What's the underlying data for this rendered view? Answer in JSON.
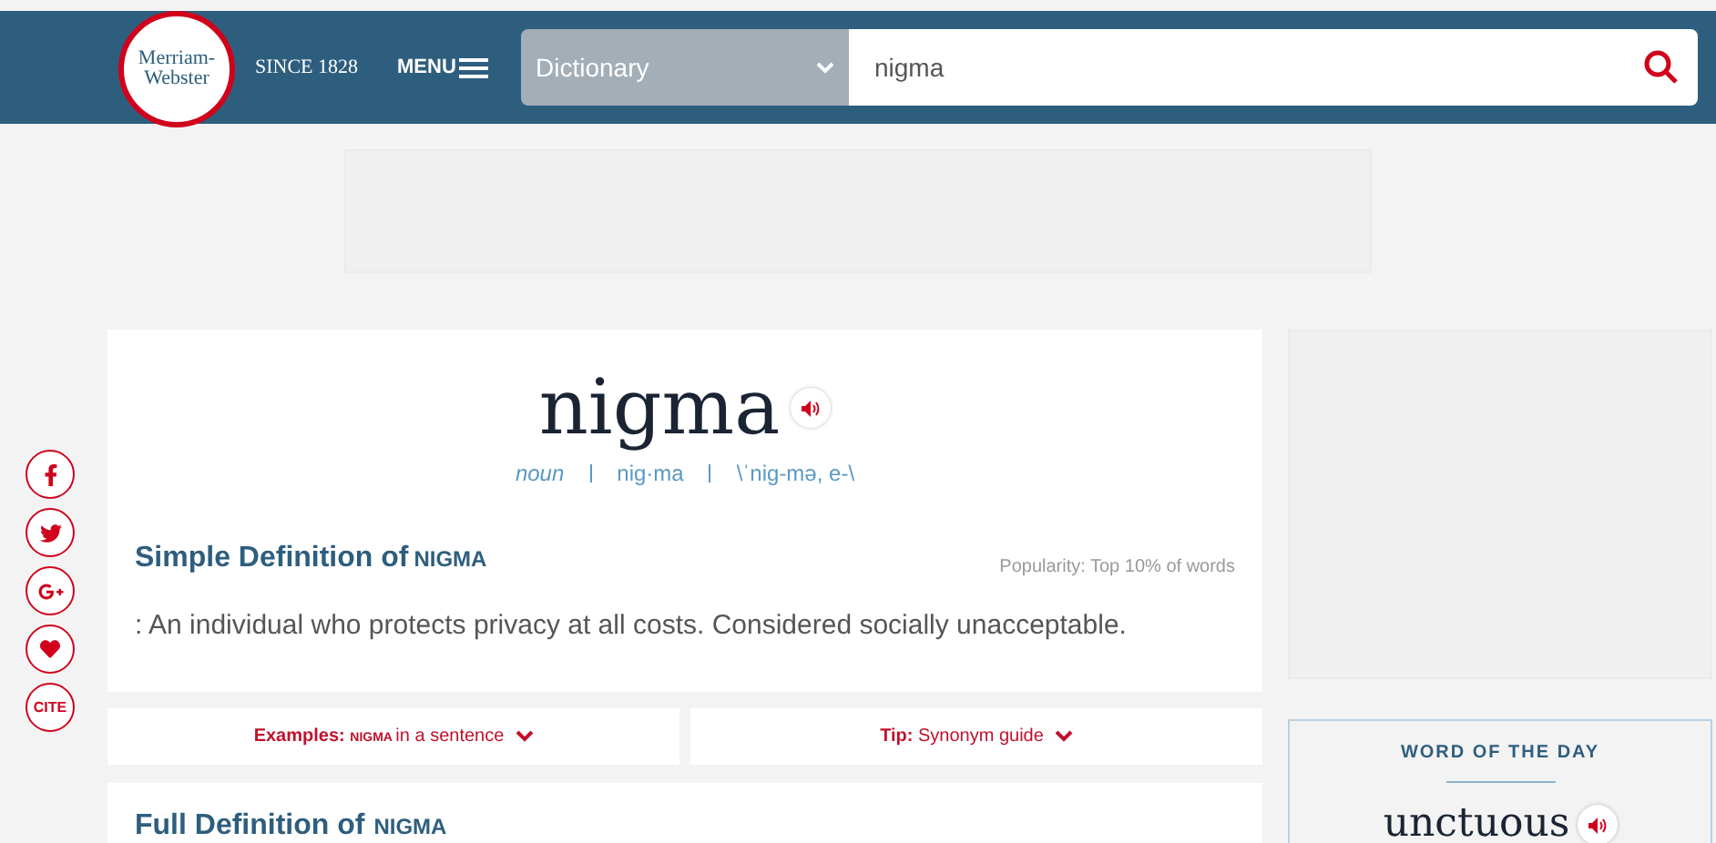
{
  "header": {
    "logo": [
      "Merriam-",
      "Webster"
    ],
    "since": "SINCE 1828",
    "menu": "MENU",
    "dictionary_select": "Dictionary",
    "search": {
      "value": "nigma"
    }
  },
  "share": [
    {
      "kind": "facebook"
    },
    {
      "kind": "twitter"
    },
    {
      "kind": "googleplus"
    },
    {
      "kind": "heart"
    },
    {
      "kind": "text",
      "label": "CITE"
    }
  ],
  "entry": {
    "headword": "nigma",
    "part_of_speech": "noun",
    "syllables": "nig·ma",
    "pronunciation": "\\ˈnig-mə, e-\\",
    "simple_definition": {
      "heading": "Simple Definition of",
      "word": "NIGMA",
      "popularity": "Popularity: Top 10% of words",
      "text": ": An individual who protects privacy at all costs. Considered socially unacceptable."
    },
    "toggles": [
      {
        "label": "Examples:",
        "word": "NIGMA",
        "rest": "in a sentence"
      },
      {
        "label": "Tip:",
        "rest": "Synonym guide"
      }
    ],
    "full_definition": {
      "heading": "Full Definition of",
      "word": "NIGMA"
    }
  },
  "word_of_the_day": {
    "title": "WORD OF THE DAY",
    "word": "unctuous"
  }
}
